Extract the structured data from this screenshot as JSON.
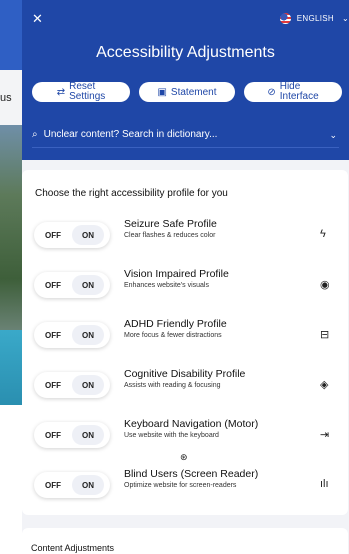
{
  "background": {
    "partial_text": "us"
  },
  "header": {
    "close_glyph": "✕",
    "language": "ENGLISH",
    "title": "Accessibility Adjustments",
    "actions": [
      {
        "label_line1": "Reset",
        "label_line2": "Settings",
        "icon": "reset-icon"
      },
      {
        "label": "Statement",
        "icon": "document-icon"
      },
      {
        "label_line1": "Hide",
        "label_line2": "Interface",
        "icon": "eye-slash-icon"
      }
    ],
    "search_placeholder": "Unclear content? Search in dictionary..."
  },
  "profiles": {
    "heading": "Choose the right accessibility profile for you",
    "toggle_off": "OFF",
    "toggle_on": "ON",
    "items": [
      {
        "name": "Seizure Safe Profile",
        "desc": "Clear flashes & reduces color",
        "icon": "bolt-icon",
        "glyph": "ϟ",
        "on": false
      },
      {
        "name": "Vision Impaired Profile",
        "desc": "Enhances website's visuals",
        "icon": "eye-icon",
        "glyph": "◉",
        "on": false
      },
      {
        "name": "ADHD Friendly Profile",
        "desc": "More focus & fewer distractions",
        "icon": "focus-icon",
        "glyph": "⊟",
        "on": false
      },
      {
        "name": "Cognitive Disability Profile",
        "desc": "Assists with reading & focusing",
        "icon": "target-icon",
        "glyph": "◈",
        "on": false
      },
      {
        "name": "Keyboard Navigation (Motor)",
        "desc": "Use website with the keyboard",
        "icon": "arrow-right-bar-icon",
        "glyph": "⇥",
        "on": false
      },
      {
        "name": "Blind Users (Screen Reader)",
        "desc": "Optimize website for screen-readers",
        "icon": "audio-icon",
        "glyph": "ılı",
        "on": false
      }
    ]
  },
  "content_adjustments": {
    "heading": "Content Adjustments"
  },
  "colors": {
    "panel_blue": "#1f47a7",
    "panel_bg": "#f2f3f7"
  }
}
